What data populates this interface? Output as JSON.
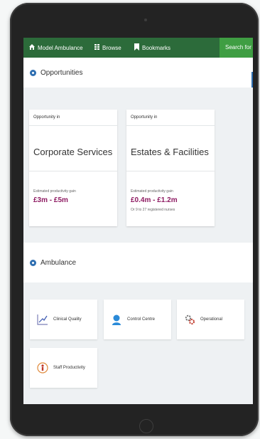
{
  "navbar": {
    "home_label": "Model Ambulance",
    "browse_label": "Browse",
    "bookmarks_label": "Bookmarks",
    "search_placeholder": "Search for a r"
  },
  "sections": {
    "opportunities_title": "Opportunities",
    "ambulance_title": "Ambulance"
  },
  "opportunities": [
    {
      "kicker": "Opportunity in",
      "name": "Corporate Services",
      "gain_label": "Estimated productivity gain",
      "gain_value": "£3m - £5m",
      "note": ""
    },
    {
      "kicker": "Opportunity in",
      "name": "Estates & Facilities",
      "gain_label": "Estimated productivity gain",
      "gain_value": "£0.4m - £1.2m",
      "note": "Or 9 to 27 registered nurses"
    }
  ],
  "ambulance_cards": [
    {
      "label": "Clinical Quality",
      "icon": "chart-icon"
    },
    {
      "label": "Control Centre",
      "icon": "operator-icon"
    },
    {
      "label": "Operational",
      "icon": "gears-icon"
    },
    {
      "label": "Staff Productivity",
      "icon": "staff-icon"
    }
  ],
  "colors": {
    "nav_green": "#2c6b3a",
    "search_green": "#3f9e43",
    "accent_blue": "#2f6fb1",
    "value_magenta": "#8e1b62"
  }
}
